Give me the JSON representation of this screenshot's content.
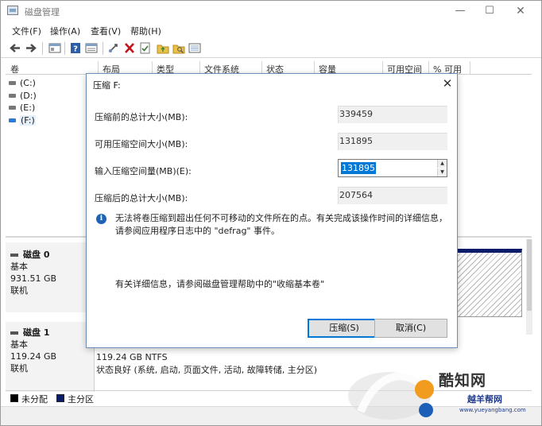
{
  "window": {
    "title": "磁盘管理"
  },
  "menu": [
    "文件(F)",
    "操作(A)",
    "查看(V)",
    "帮助(H)"
  ],
  "volume_table": {
    "columns": [
      "卷",
      "布局",
      "类型",
      "文件系统",
      "状态",
      "容量",
      "可用空间",
      "% 可用"
    ],
    "rows": [
      "(C:)",
      "(D:)",
      "(E:)",
      "(F:)"
    ],
    "selected": "(F:)"
  },
  "disks": [
    {
      "name": "磁盘 0",
      "type": "基本",
      "size": "931.51 GB",
      "status": "联机"
    },
    {
      "name": "磁盘 1",
      "type": "基本",
      "size": "119.24 GB",
      "status": "联机"
    }
  ],
  "partition_f": {
    "size_fs": "119.24 GB NTFS",
    "status": "状态良好 (系统, 启动, 页面文件, 活动, 故障转储, 主分区)"
  },
  "legend": [
    {
      "label": "未分配",
      "color": "#000000"
    },
    {
      "label": "主分区",
      "color": "#0b1c6b"
    }
  ],
  "dialog": {
    "title": "压缩 F:",
    "close_glyph": "✕",
    "total_before_label": "压缩前的总计大小(MB):",
    "total_before_value": "339459",
    "available_label": "可用压缩空间大小(MB):",
    "available_value": "131895",
    "input_label": "输入压缩空间量(MB)(E):",
    "input_value": "131895",
    "total_after_label": "压缩后的总计大小(MB):",
    "total_after_value": "207564",
    "info": "无法将卷压缩到超出任何不可移动的文件所在的点。有关完成该操作时间的详细信息，请参阅应用程序日志中的 \"defrag\" 事件。",
    "help": "有关详细信息，请参阅磁盘管理帮助中的\"收缩基本卷\"",
    "ok_button": "压缩(S)",
    "cancel_button": "取消(C)"
  },
  "watermark": {
    "brand": "酷知网",
    "sub": "越羊帮网",
    "url": "www.yueyangbang.com"
  },
  "colors": {
    "accent": "#0078d7",
    "primary_partition": "#0b1c6b"
  }
}
